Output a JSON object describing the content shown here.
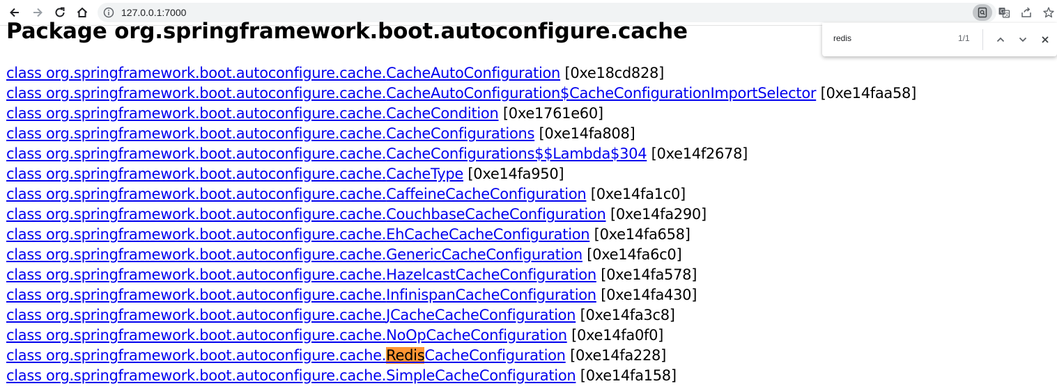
{
  "browser": {
    "url": "127.0.0.1:7000",
    "find": {
      "query": "redis",
      "count": "1/1"
    }
  },
  "page": {
    "title": "Package org.springframework.boot.autoconfigure.cache",
    "classes": [
      {
        "prefix": "class org.springframework.boot.autoconfigure.cache.",
        "match": "",
        "suffix": "CacheAutoConfiguration",
        "addr": "[0xe18cd828]"
      },
      {
        "prefix": "class org.springframework.boot.autoconfigure.cache.",
        "match": "",
        "suffix": "CacheAutoConfiguration$CacheConfigurationImportSelector",
        "addr": "[0xe14faa58]"
      },
      {
        "prefix": "class org.springframework.boot.autoconfigure.cache.",
        "match": "",
        "suffix": "CacheCondition",
        "addr": "[0xe1761e60]"
      },
      {
        "prefix": "class org.springframework.boot.autoconfigure.cache.",
        "match": "",
        "suffix": "CacheConfigurations",
        "addr": "[0xe14fa808]"
      },
      {
        "prefix": "class org.springframework.boot.autoconfigure.cache.",
        "match": "",
        "suffix": "CacheConfigurations$$Lambda$304",
        "addr": "[0xe14f2678]"
      },
      {
        "prefix": "class org.springframework.boot.autoconfigure.cache.",
        "match": "",
        "suffix": "CacheType",
        "addr": "[0xe14fa950]"
      },
      {
        "prefix": "class org.springframework.boot.autoconfigure.cache.",
        "match": "",
        "suffix": "CaffeineCacheConfiguration",
        "addr": "[0xe14fa1c0]"
      },
      {
        "prefix": "class org.springframework.boot.autoconfigure.cache.",
        "match": "",
        "suffix": "CouchbaseCacheConfiguration",
        "addr": "[0xe14fa290]"
      },
      {
        "prefix": "class org.springframework.boot.autoconfigure.cache.",
        "match": "",
        "suffix": "EhCacheCacheConfiguration",
        "addr": "[0xe14fa658]"
      },
      {
        "prefix": "class org.springframework.boot.autoconfigure.cache.",
        "match": "",
        "suffix": "GenericCacheConfiguration",
        "addr": "[0xe14fa6c0]"
      },
      {
        "prefix": "class org.springframework.boot.autoconfigure.cache.",
        "match": "",
        "suffix": "HazelcastCacheConfiguration",
        "addr": "[0xe14fa578]"
      },
      {
        "prefix": "class org.springframework.boot.autoconfigure.cache.",
        "match": "",
        "suffix": "InfinispanCacheConfiguration",
        "addr": "[0xe14fa430]"
      },
      {
        "prefix": "class org.springframework.boot.autoconfigure.cache.",
        "match": "",
        "suffix": "JCacheCacheConfiguration",
        "addr": "[0xe14fa3c8]"
      },
      {
        "prefix": "class org.springframework.boot.autoconfigure.cache.",
        "match": "",
        "suffix": "NoOpCacheConfiguration",
        "addr": "[0xe14fa0f0]"
      },
      {
        "prefix": "class org.springframework.boot.autoconfigure.cache.",
        "match": "Redis",
        "suffix": "CacheConfiguration",
        "addr": "[0xe14fa228]"
      },
      {
        "prefix": "class org.springframework.boot.autoconfigure.cache.",
        "match": "",
        "suffix": "SimpleCacheConfiguration",
        "addr": "[0xe14fa158]"
      }
    ]
  },
  "colors": {
    "link": "#0000ee",
    "find_highlight": "#ff9632"
  },
  "icons": [
    "back-icon",
    "forward-icon",
    "reload-icon",
    "home-icon",
    "site-info-icon",
    "find-icon",
    "translate-icon",
    "share-icon",
    "bookmark-star-icon",
    "chevron-up-icon",
    "chevron-down-icon",
    "close-icon"
  ]
}
